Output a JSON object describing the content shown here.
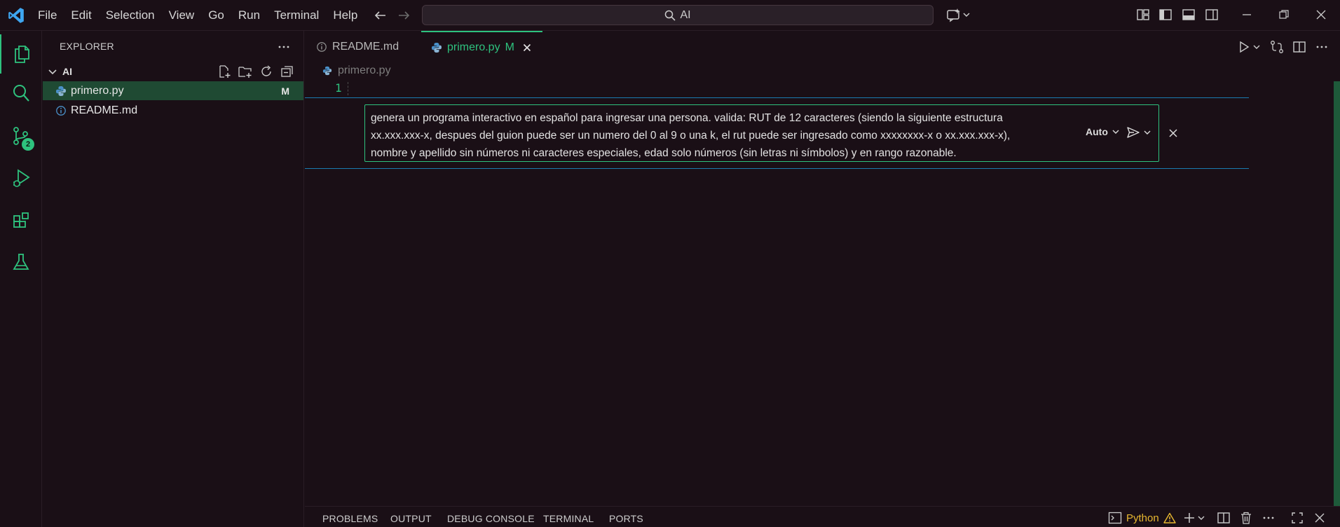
{
  "menu": {
    "items": [
      "File",
      "Edit",
      "Selection",
      "View",
      "Go",
      "Run",
      "Terminal",
      "Help"
    ]
  },
  "search": {
    "text": "AI"
  },
  "title_icons": [
    "copilot-icon",
    "layout-icon",
    "toggle-sidebar-icon",
    "toggle-panel-icon",
    "toggle-secondary-sidebar-icon",
    "minimize-icon",
    "restore-icon",
    "close-window-icon"
  ],
  "activity": {
    "items": [
      "explorer-icon",
      "search-icon",
      "source-control-icon",
      "run-debug-icon",
      "extensions-icon",
      "testing-icon"
    ],
    "source_control_badge": "2"
  },
  "sidebar": {
    "header": "EXPLORER",
    "folder": "AI",
    "files": [
      {
        "name": "primero.py",
        "status": "M",
        "icon": "python-icon"
      },
      {
        "name": "README.md",
        "status": "",
        "icon": "info-icon"
      }
    ]
  },
  "editor": {
    "tabs": [
      {
        "label": "README.md",
        "icon": "info-icon",
        "modified": ""
      },
      {
        "label": "primero.py",
        "icon": "python-icon",
        "modified": "M"
      }
    ],
    "breadcrumb": "primero.py",
    "line_number": "1"
  },
  "inline_chat": {
    "prompt_line1": "genera un programa interactivo en español para ingresar una persona. valida: RUT de 12 caracteres (siendo la siguiente estructura",
    "prompt_line2": "xx.xxx.xxx-x, despues del guion puede ser un numero del 0 al 9 o una k, el rut puede ser ingresado como xxxxxxxx-x o xx.xxx.xxx-x),",
    "prompt_line3": "nombre y apellido sin números ni caracteres especiales, edad solo números (sin letras ni símbolos) y en rango razonable.",
    "mode_label": "Auto"
  },
  "panel": {
    "tabs": [
      "PROBLEMS",
      "OUTPUT",
      "DEBUG CONSOLE",
      "TERMINAL",
      "PORTS"
    ],
    "terminal_label": "Python"
  },
  "colors": {
    "background": "#1a0f16",
    "accent": "#2ec27e",
    "selection": "#1f4a33",
    "zone_border": "#1a7bb0",
    "warning": "#e8b830"
  }
}
